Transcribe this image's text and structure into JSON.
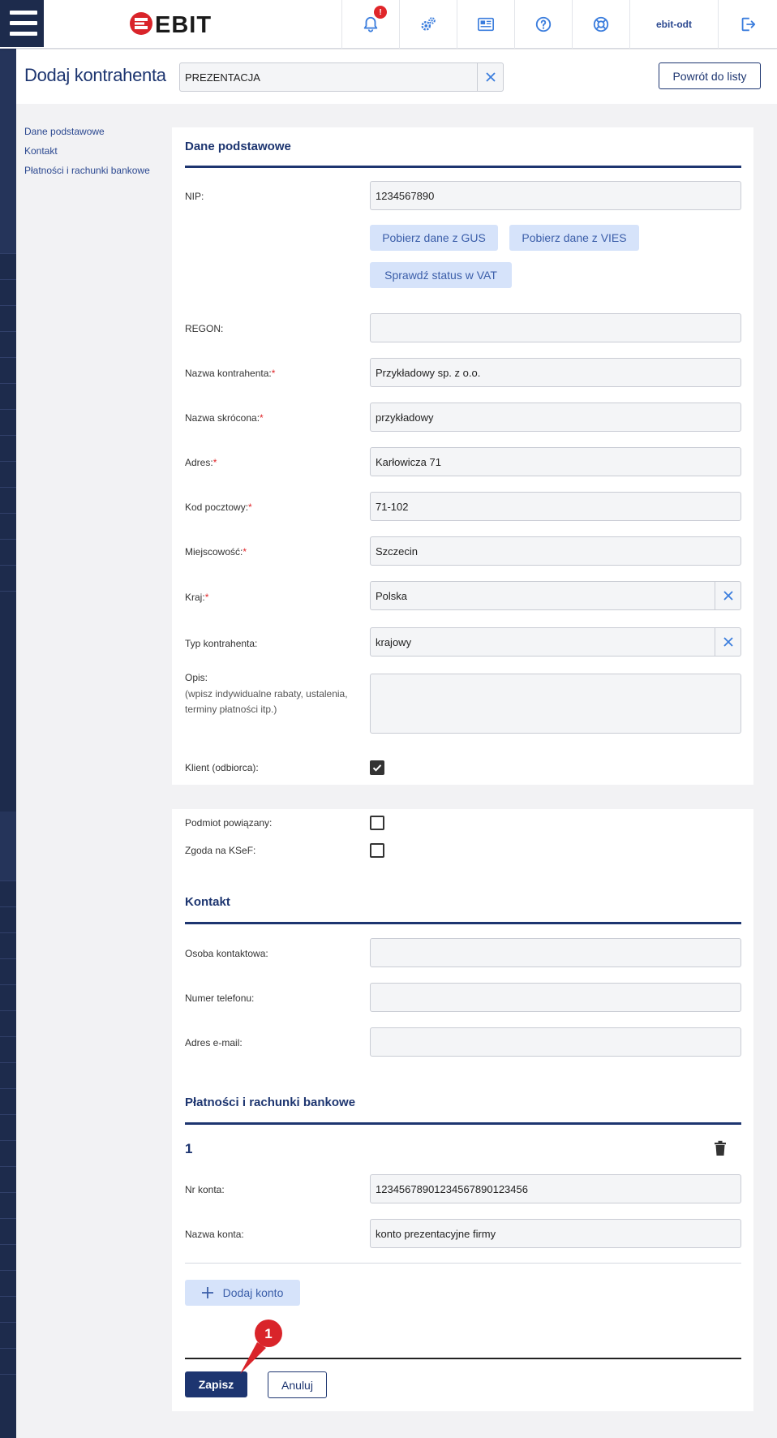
{
  "topbar": {
    "logo_text": "EBIT",
    "notification_count": "!",
    "user_name": "ebit-odt"
  },
  "header": {
    "title": "Dodaj kontrahenta",
    "search_value": "PREZENTACJA",
    "back_label": "Powrót do listy"
  },
  "anchor_nav": [
    "Dane podstawowe",
    "Kontakt",
    "Płatności i rachunki bankowe"
  ],
  "basic": {
    "section_title": "Dane podstawowe",
    "nip_label": "NIP:",
    "nip_value": "1234567890",
    "gus_button": "Pobierz dane z GUS",
    "vies_button": "Pobierz dane z VIES",
    "vat_button": "Sprawdź status w VAT",
    "regon_label": "REGON:",
    "regon_value": "",
    "name_label": "Nazwa kontrahenta:",
    "name_value": "Przykładowy sp. z o.o.",
    "short_label": "Nazwa skrócona:",
    "short_value": "przykładowy",
    "address_label": "Adres:",
    "address_value": "Karłowicza 71",
    "postal_label": "Kod pocztowy:",
    "postal_value": "71-102",
    "city_label": "Miejscowość:",
    "city_value": "Szczecin",
    "country_label": "Kraj:",
    "country_value": "Polska",
    "type_label": "Typ kontrahenta:",
    "type_value": "krajowy",
    "desc_label": "Opis:",
    "desc_hint_1": "(wpisz indywidualne rabaty, ustalenia,",
    "desc_hint_2": "terminy płatności itp.)",
    "client_label": "Klient (odbiorca):",
    "related_label": "Podmiot powiązany:",
    "ksef_label": "Zgoda na KSeF:",
    "required_mark": "*"
  },
  "contact": {
    "section_title": "Kontakt",
    "person_label": "Osoba kontaktowa:",
    "phone_label": "Numer telefonu:",
    "email_label": "Adres e-mail:"
  },
  "payments": {
    "section_title": "Płatności i rachunki bankowe",
    "account_index": "1",
    "account_no_label": "Nr konta:",
    "account_no_value": "12345678901234567890123456",
    "account_name_label": "Nazwa konta:",
    "account_name_value": "konto prezentacyjne firmy",
    "add_account_label": "Dodaj konto"
  },
  "footer": {
    "save_label": "Zapisz",
    "cancel_label": "Anuluj"
  },
  "annotation": {
    "marker_number": "1"
  },
  "colors": {
    "brand_navy": "#1d3570",
    "sidebar": "#1d2b4c",
    "logo_red": "#d9242a",
    "accent_blue": "#3b7ddd",
    "light_button": "#d6e3fa"
  }
}
